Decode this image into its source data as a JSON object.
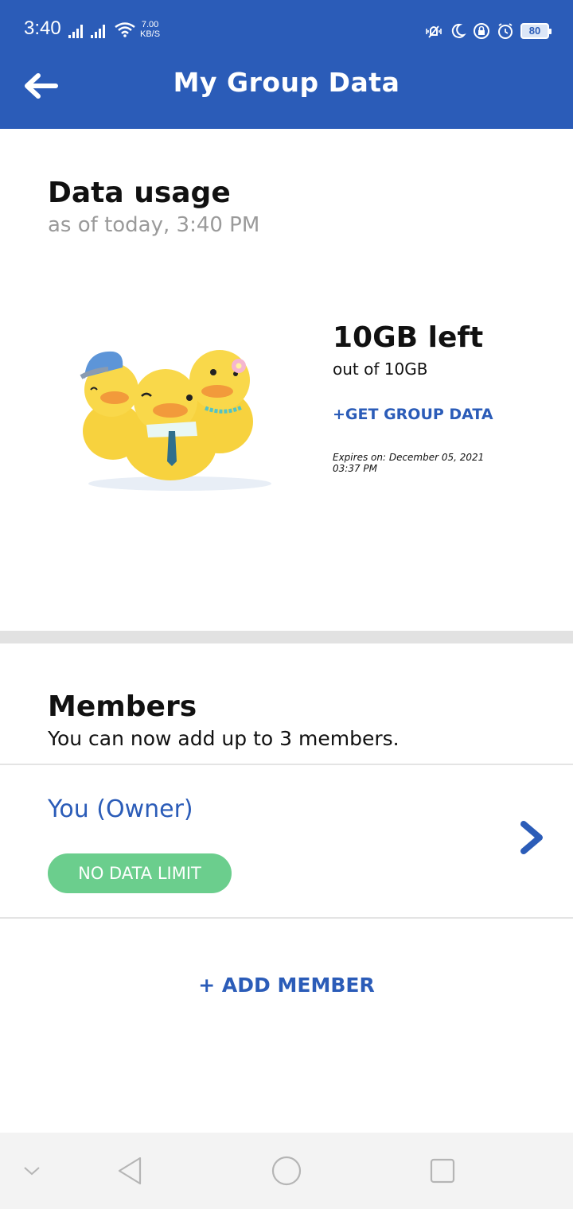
{
  "status_bar": {
    "time": "3:40",
    "net_speed_value": "7.00",
    "net_speed_unit": "KB/S",
    "battery": "80"
  },
  "app_bar": {
    "title": "My Group Data"
  },
  "data_usage": {
    "title": "Data usage",
    "subtitle": "as of today, 3:40 PM",
    "remaining": "10GB left",
    "total": "out of 10GB",
    "get_data_label": "+GET GROUP DATA",
    "expires_line1": "Expires on: December 05, 2021",
    "expires_line2": "03:37 PM"
  },
  "members": {
    "title": "Members",
    "subtitle": "You can now add up to 3 members.",
    "items": [
      {
        "name": "You (Owner)",
        "badge": "NO DATA LIMIT"
      }
    ],
    "add_label": "+ ADD MEMBER"
  },
  "colors": {
    "brand": "#2b5cb8",
    "badge_green": "#6bce8d"
  },
  "icons": [
    "back-arrow-icon",
    "chevron-right-icon",
    "wifi-icon",
    "signal-icon",
    "vibrate-icon",
    "moon-icon",
    "lock-icon",
    "alarm-icon",
    "battery-icon"
  ]
}
